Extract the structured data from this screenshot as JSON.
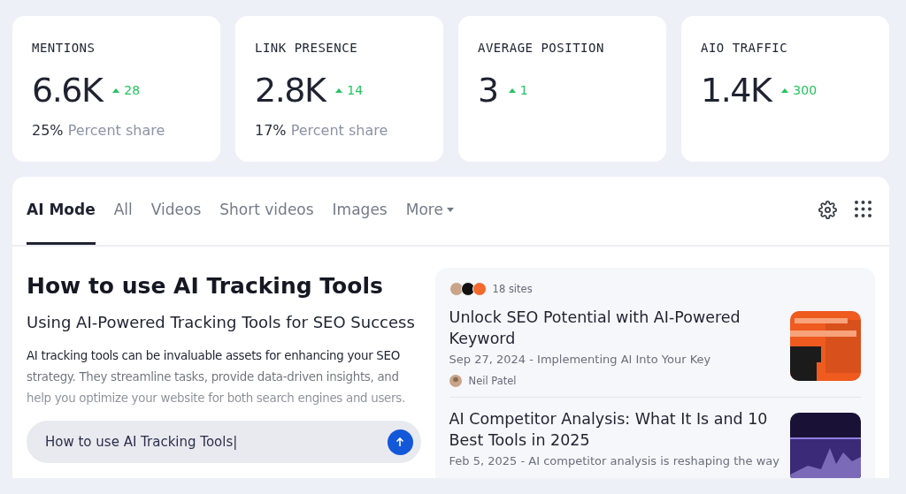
{
  "metrics": [
    {
      "label": "MENTIONS",
      "value": "6.6K",
      "delta": "28",
      "share": "25%",
      "share_label": "Percent share"
    },
    {
      "label": "LINK PRESENCE",
      "value": "2.8K",
      "delta": "14",
      "share": "17%",
      "share_label": "Percent share"
    },
    {
      "label": "AVERAGE POSITION",
      "value": "3",
      "delta": "1"
    },
    {
      "label": "AIO TRAFFIC",
      "value": "1.4K",
      "delta": "300"
    }
  ],
  "tabs": [
    {
      "label": "AI Mode",
      "selected": true
    },
    {
      "label": "All",
      "selected": false
    },
    {
      "label": "Videos",
      "selected": false
    },
    {
      "label": "Short videos",
      "selected": false
    },
    {
      "label": "Images",
      "selected": false
    },
    {
      "label": "More",
      "selected": false,
      "kind": "dropdown"
    }
  ],
  "answer": {
    "title": "How to use AI Tracking Tools",
    "subtitle": "Using AI-Powered Tracking Tools for SEO Success",
    "body": "AI tracking tools can be invaluable assets for enhancing your SEO strategy. They streamline tasks, provide data-driven insights, and help you optimize your website for both search engines and users."
  },
  "prompt": {
    "value": "How to use AI Tracking Tools|"
  },
  "sources": {
    "count": "18 sites",
    "results": [
      {
        "title": "Unlock SEO Potential with AI-Powered Keyword",
        "snippet": "Sep 27, 2024 - Implementing AI Into Your Key",
        "author": "Neil Patel"
      },
      {
        "title": "AI Competitor Analysis: What It Is and 10 Best Tools in 2025",
        "snippet": "Feb 5, 2025 - AI competitor analysis is reshaping the way"
      }
    ]
  }
}
